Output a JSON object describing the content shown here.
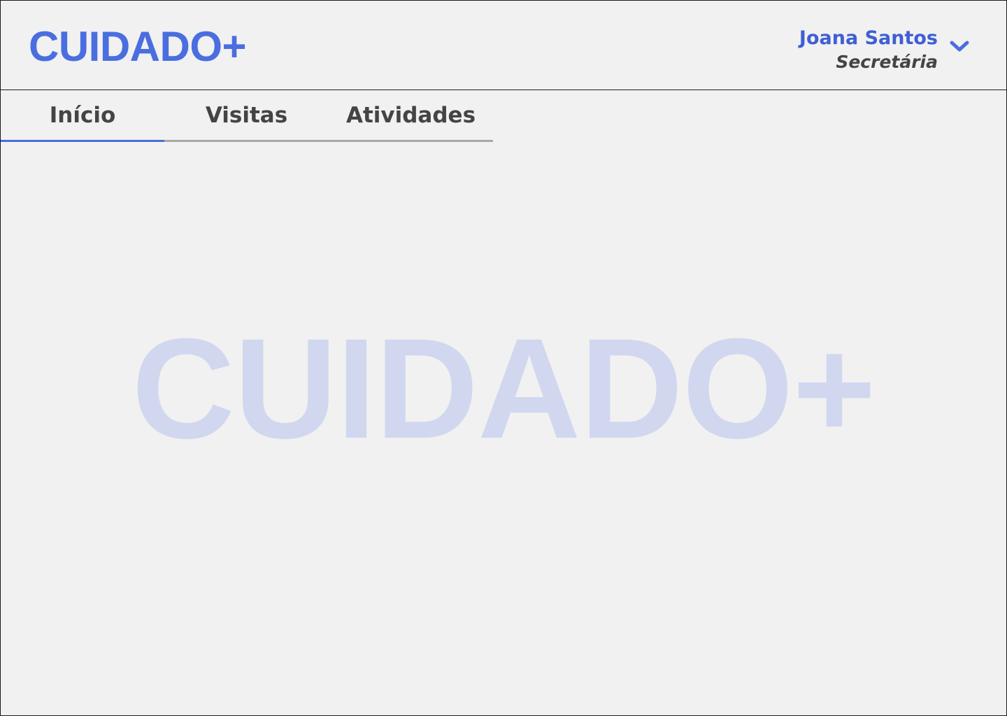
{
  "app": {
    "logo": "CUIDADO+",
    "watermark": "CUIDADO+"
  },
  "user": {
    "name": "Joana Santos",
    "role": "Secretária",
    "menu_icon": "chevron-down-icon"
  },
  "tabs": [
    {
      "label": "Início",
      "active": true
    },
    {
      "label": "Visitas",
      "active": false
    },
    {
      "label": "Atividades",
      "active": false
    }
  ],
  "colors": {
    "brand": "#4a6ee0",
    "watermark": "#d1d7ef",
    "background": "#f1f1f1",
    "text": "#444444",
    "tab_inactive_underline": "#a8a8a8"
  }
}
